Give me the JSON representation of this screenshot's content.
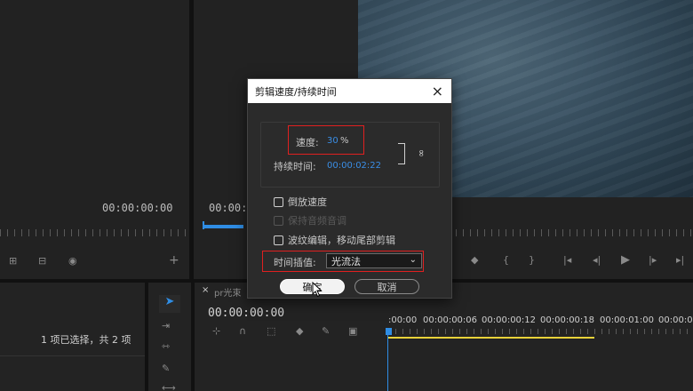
{
  "source_monitor": {
    "timecode": "00:00:00:00"
  },
  "program_monitor": {
    "timecode": "00:00:0"
  },
  "project_panel": {
    "status": "1 项已选择，共 2 项"
  },
  "timeline": {
    "tab_label": "pr光束",
    "timecode": "00:00:00:00",
    "ruler_labels": [
      ":00:00",
      "00:00:00:06",
      "00:00:00:12",
      "00:00:00:18",
      "00:00:01:00",
      "00:00:01"
    ]
  },
  "dialog": {
    "title": "剪辑速度/持续时间",
    "speed_label": "速度:",
    "speed_value": "30",
    "speed_unit": "%",
    "duration_label": "持续时间:",
    "duration_value": "00:00:02:22",
    "options": [
      {
        "label": "倒放速度",
        "enabled": true,
        "checked": false
      },
      {
        "label": "保持音频音调",
        "enabled": false,
        "checked": false
      },
      {
        "label": "波纹编辑，移动尾部剪辑",
        "enabled": true,
        "checked": false
      }
    ],
    "interp_label": "时间插值:",
    "interp_value": "光流法",
    "ok_label": "确定",
    "cancel_label": "取消"
  },
  "colors": {
    "accent_blue": "#3a8ee6",
    "highlight_red": "#e02020",
    "playhead": "#2f8de4",
    "work_area": "#e8d23a"
  }
}
